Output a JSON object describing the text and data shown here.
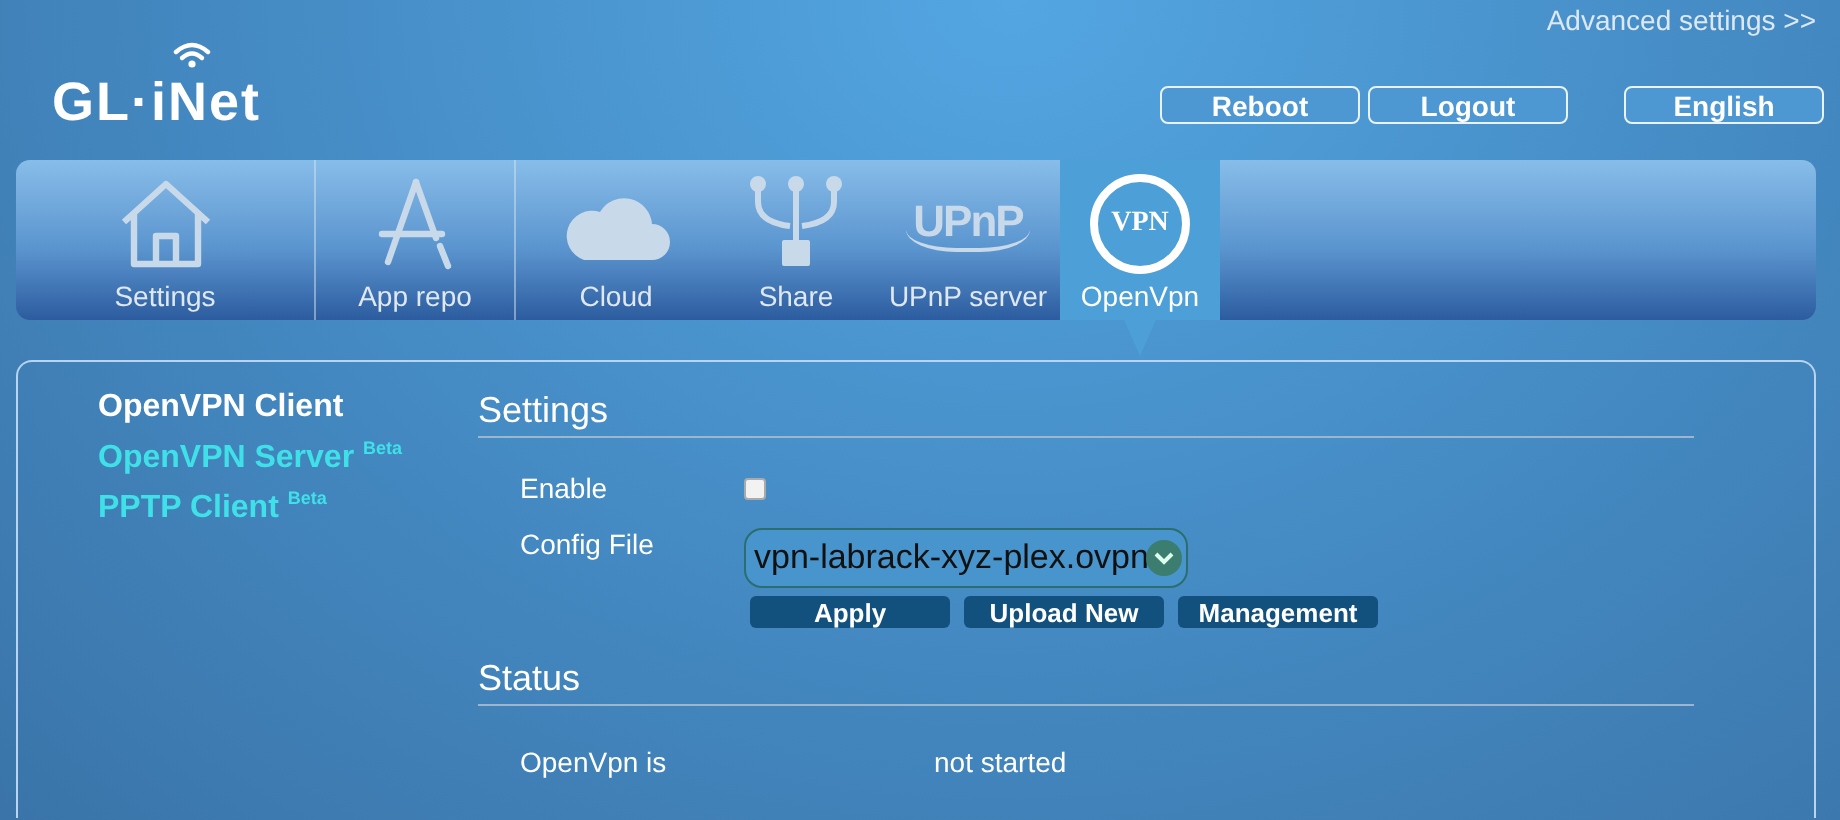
{
  "header": {
    "advanced_link": "Advanced settings >>",
    "logo": "GL·iNet",
    "buttons": [
      "Reboot",
      "Logout",
      "English"
    ]
  },
  "nav": {
    "tabs": [
      {
        "label": "Settings",
        "kind": "house",
        "selected": false
      },
      {
        "label": "App repo",
        "kind": "app",
        "selected": false
      },
      {
        "label": "Cloud",
        "kind": "cloud",
        "selected": false
      },
      {
        "label": "Share",
        "kind": "share",
        "selected": false
      },
      {
        "label": "UPnP server",
        "kind": "text",
        "icon_text": "UPnP",
        "selected": false
      },
      {
        "label": "OpenVpn",
        "kind": "ring",
        "icon_text": "VPN",
        "selected": true
      }
    ]
  },
  "sidebar": {
    "items": [
      {
        "label": "OpenVPN Client",
        "selected": true
      },
      {
        "label": "OpenVPN Server $^{Beta}$",
        "selected": false
      },
      {
        "label": "PPTP Client $^{Beta}$",
        "selected": false
      }
    ]
  },
  "settings": {
    "title": "Settings",
    "enable": {
      "label": "Enable",
      "checked": false
    },
    "config": {
      "label": "Config File",
      "value": "vpn-labrack-xyz-plex.ovpn"
    },
    "buttons": [
      "Apply",
      "Upload New",
      "Management"
    ]
  },
  "status": {
    "title": "Status",
    "rows": [
      {
        "label": "OpenVpn is",
        "value": "not started"
      }
    ]
  }
}
